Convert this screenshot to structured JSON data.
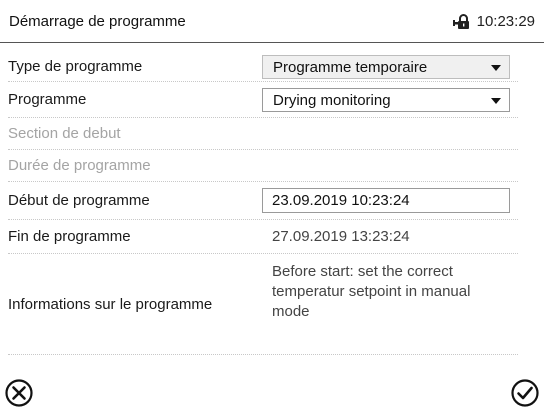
{
  "header": {
    "title": "Démarrage de programme",
    "time": "10:23:29",
    "lock_icon": "door-lock-icon"
  },
  "form": {
    "type_label": "Type de programme",
    "type_value": "Programme temporaire",
    "program_label": "Programme",
    "program_value": "Drying monitoring",
    "section_label": "Section de debut",
    "duration_label": "Durée de programme",
    "start_label": "Début de programme",
    "start_value": "23.09.2019 10:23:24",
    "end_label": "Fin de programme",
    "end_value": "27.09.2019 13:23:24",
    "info_label": "Informations sur le programme",
    "info_value": "Before start: set the correct temperatur setpoint in manual mode"
  },
  "footer": {
    "cancel_icon": "close-circle-icon",
    "confirm_icon": "check-circle-icon"
  },
  "colors": {
    "text": "#1a1a1a",
    "disabled_text": "#a4a4a4",
    "value_text": "#444444",
    "select_bg": "#f0f0f0"
  }
}
